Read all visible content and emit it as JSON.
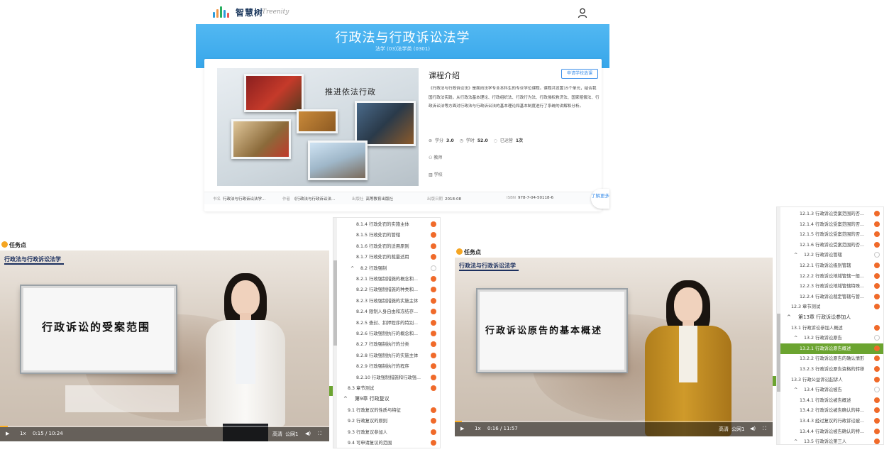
{
  "course": {
    "logo_text": "智慧树",
    "logo_en": "Treenity",
    "title": "行政法与行政诉讼法学",
    "subtitle": "法学 (03)法学类 (0301)",
    "cover_text": "推进依法行政",
    "intro_heading": "课程介绍",
    "apply_button": "申请学校选课",
    "intro_text": "《行政法与行政诉讼法》是面向法学专业本科生的专业学位课程。课程共设置15个单元，结合我国行政法实践，从行政法基本理论、行政组织法、行政行为法、行政侵权救济法、国家赔偿法、行政诉讼法等方面对行政法与行政诉讼法的基本理论和基本制度进行了系统的讲解和分析。",
    "stats": {
      "credit_label": "学分",
      "credit_value": "3.0",
      "hours_label": "学时",
      "hours_value": "52.0",
      "runs_label": "已运营",
      "runs_value": "1次"
    },
    "teacher_label": "教师",
    "school_label": "学校",
    "book": {
      "name_label": "书名",
      "name_value": "行政法与行政诉讼法学...",
      "author_label": "作者",
      "author_value": "《行政法与行政诉讼法...",
      "publisher_label": "出版社",
      "publisher_value": "高等教育出版社",
      "date_label": "出版日期",
      "date_value": "2018-08",
      "isbn_label": "ISBN",
      "isbn_value": "978-7-04-50118-6"
    },
    "more_button": "了解更多"
  },
  "player_left": {
    "task_label": "任务点",
    "watermark": "行政法与行政诉讼法学",
    "board_text": "行政诉讼的受案范围",
    "speed": "1x",
    "time": "0:15 / 10:24",
    "quality": "高清",
    "route": "公网1",
    "progress": 0.024
  },
  "player_right": {
    "task_label": "任务点",
    "watermark": "行政法与行政诉讼法学",
    "board_text": "行政诉讼原告的基本概述",
    "speed": "1x",
    "time": "0:16 / 11:57",
    "quality": "高清",
    "route": "公网1",
    "progress": 0.022
  },
  "toc_left": [
    {
      "text": "8.1.4 行政处罚的实施主体",
      "level": 3,
      "status": "o"
    },
    {
      "text": "8.1.5 行政处罚的管辖",
      "level": 3,
      "status": "o"
    },
    {
      "text": "8.1.6 行政处罚的适用原则",
      "level": 3,
      "status": "o"
    },
    {
      "text": "8.1.7 行政处罚的裁量适用",
      "level": 3,
      "status": "o"
    },
    {
      "text": "8.2 行政强制",
      "level": 2,
      "status": "e",
      "caret": "^"
    },
    {
      "text": "8.2.1 行政强制措施的概念和...",
      "level": 3,
      "status": "o"
    },
    {
      "text": "8.2.2 行政强制措施的种类和...",
      "level": 3,
      "status": "o"
    },
    {
      "text": "8.2.3 行政强制措施的实施主体",
      "level": 3,
      "status": "o"
    },
    {
      "text": "8.2.4 限制人身自由和冻结存...",
      "level": 3,
      "status": "o"
    },
    {
      "text": "8.2.5 查封、扣押程序的特别...",
      "level": 3,
      "status": "o"
    },
    {
      "text": "8.2.6 行政强制执行的概念和...",
      "level": 3,
      "status": "o"
    },
    {
      "text": "8.2.7 行政强制执行的分类",
      "level": 3,
      "status": "o"
    },
    {
      "text": "8.2.8 行政强制执行的实施主体",
      "level": 3,
      "status": "o"
    },
    {
      "text": "8.2.9 行政强制执行的程序",
      "level": 3,
      "status": "o"
    },
    {
      "text": "8.2.10 行政强制措施和行政强...",
      "level": 3,
      "status": "o"
    },
    {
      "text": "8.3 章节测试",
      "level": 1,
      "status": "o"
    },
    {
      "text": "第9章 行政复议",
      "level": 0,
      "status": "",
      "caret": "^"
    },
    {
      "text": "9.1 行政复议的性质与特征",
      "level": 1,
      "status": "o"
    },
    {
      "text": "9.2 行政复议的原则",
      "level": 1,
      "status": "o"
    },
    {
      "text": "9.3 行政复议参加人",
      "level": 1,
      "status": "o"
    },
    {
      "text": "9.4 可申请复议的范围",
      "level": 1,
      "status": "o"
    }
  ],
  "toc_right": [
    {
      "text": "12.1.3 行政诉讼受案范围的否...",
      "level": 3,
      "status": "o"
    },
    {
      "text": "12.1.4 行政诉讼受案范围的否...",
      "level": 3,
      "status": "o"
    },
    {
      "text": "12.1.5 行政诉讼受案范围的否...",
      "level": 3,
      "status": "o"
    },
    {
      "text": "12.1.6 行政诉讼受案范围的否...",
      "level": 3,
      "status": "o"
    },
    {
      "text": "12.2 行政诉讼管辖",
      "level": 2,
      "status": "e",
      "caret": "^"
    },
    {
      "text": "12.2.1 行政诉讼级别管辖",
      "level": 3,
      "status": "o"
    },
    {
      "text": "12.2.2 行政诉讼地域管辖一般...",
      "level": 3,
      "status": "o"
    },
    {
      "text": "12.2.3 行政诉讼地域管辖特殊...",
      "level": 3,
      "status": "o"
    },
    {
      "text": "12.2.4 行政诉讼裁定管辖与管...",
      "level": 3,
      "status": "o"
    },
    {
      "text": "12.3 章节测试",
      "level": 1,
      "status": "o"
    },
    {
      "text": "第13章 行政诉讼参加人",
      "level": 0,
      "status": "",
      "caret": "^"
    },
    {
      "text": "13.1 行政诉讼参加人概述",
      "level": 1,
      "status": "o"
    },
    {
      "text": "13.2 行政诉讼原告",
      "level": 2,
      "status": "e",
      "caret": "^"
    },
    {
      "text": "13.2.1 行政诉讼原告概述",
      "level": 3,
      "status": "o",
      "selected": true
    },
    {
      "text": "13.2.2 行政诉讼原告的确认情形",
      "level": 3,
      "status": "o"
    },
    {
      "text": "13.2.3 行政诉讼原告资格的转移",
      "level": 3,
      "status": "o"
    },
    {
      "text": "13.3 行政公益诉讼起诉人",
      "level": 1,
      "status": "o"
    },
    {
      "text": "13.4 行政诉讼被告",
      "level": 2,
      "status": "e",
      "caret": "^"
    },
    {
      "text": "13.4.1 行政诉讼被告概述",
      "level": 3,
      "status": "o"
    },
    {
      "text": "13.4.2 行政诉讼被告确认的特...",
      "level": 3,
      "status": "o"
    },
    {
      "text": "13.4.3 经过复议的行政诉讼被...",
      "level": 3,
      "status": "o"
    },
    {
      "text": "13.4.4 行政诉讼被告确认的特...",
      "level": 3,
      "status": "o"
    },
    {
      "text": "13.5 行政诉讼第三人",
      "level": 2,
      "status": "o",
      "caret": "^"
    }
  ],
  "colors": {
    "accent": "#37a6ea",
    "progress": "#ffb020",
    "dot": "#f06a2a",
    "selected": "#6ba430"
  }
}
